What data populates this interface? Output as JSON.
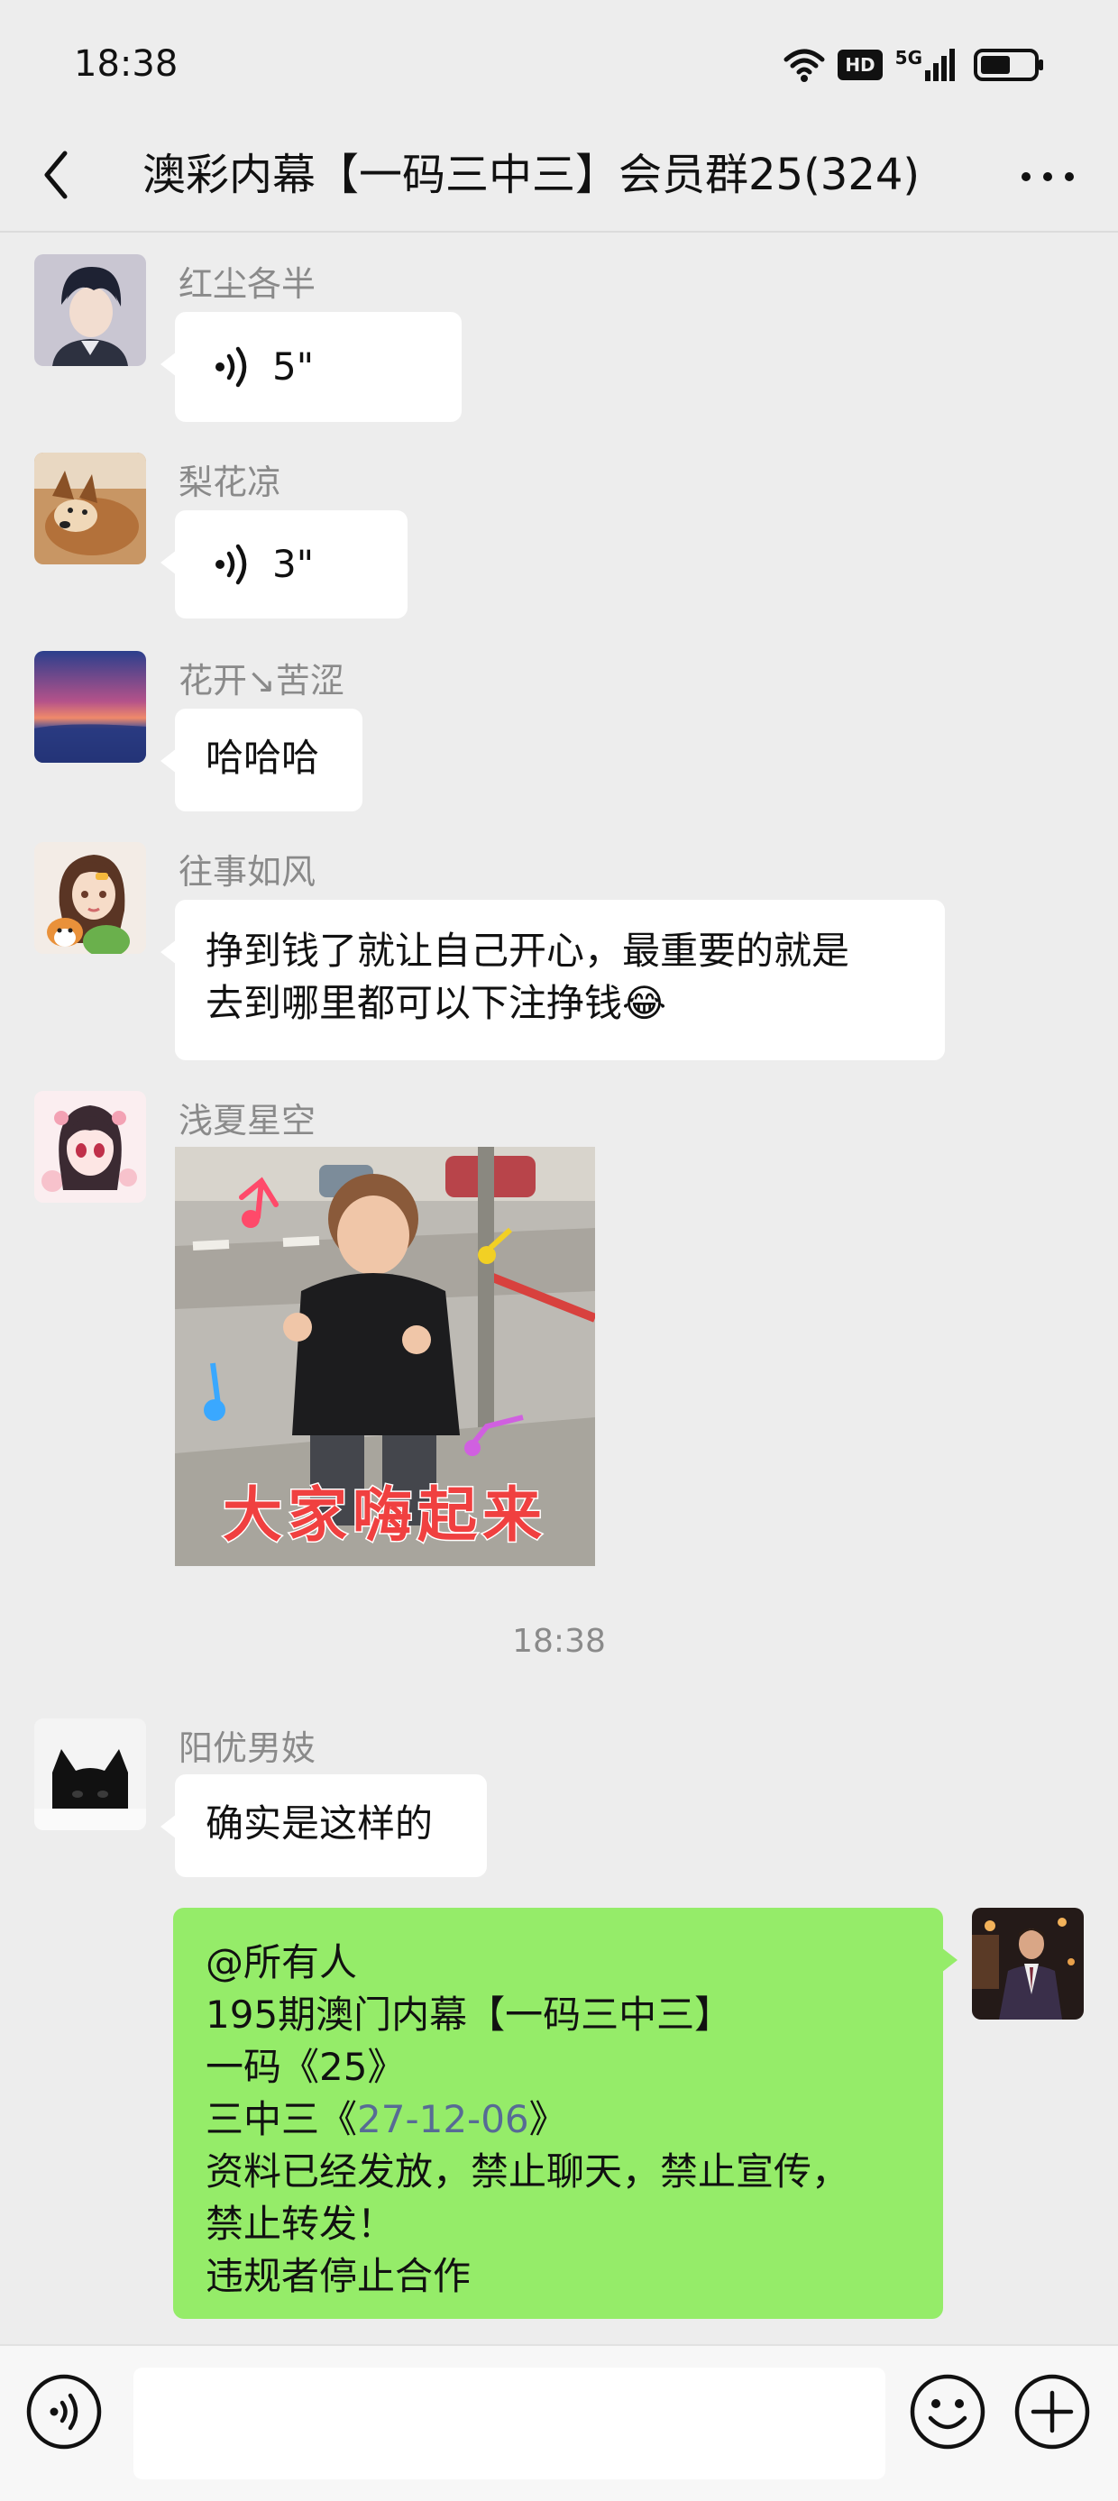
{
  "status": {
    "time": "18:38",
    "hd": "HD",
    "network": "5G",
    "icons": [
      "wifi-icon",
      "hd-icon",
      "signal-icon",
      "battery-icon"
    ]
  },
  "nav": {
    "title": "澳彩内幕【一码三中三】会员群25(324)",
    "back_icon": "chevron-left-icon",
    "more_icon": "more-icon"
  },
  "messages": [
    {
      "sender": "红尘各半",
      "type": "voice",
      "duration": "5\""
    },
    {
      "sender": "梨花凉",
      "type": "voice",
      "duration": "3\""
    },
    {
      "sender": "花开↘苦涩",
      "type": "text",
      "text": "哈哈哈"
    },
    {
      "sender": "往事如风",
      "type": "text",
      "lines": [
        "挣到钱了就让自己开心，最重要的就是",
        "去到哪里都可以下注挣钱"
      ],
      "emoji": "😂"
    },
    {
      "sender": "浅夏星空",
      "type": "sticker",
      "caption": "大家嗨起来"
    }
  ],
  "timestamp": "18:38",
  "later_messages": [
    {
      "sender": "阳优男妓",
      "type": "text",
      "text": "确实是这样的"
    }
  ],
  "own_message": {
    "line1": "@所有人",
    "line2": "195期澳门内幕【一码三中三】",
    "line3": "一码《25》",
    "line4_prefix": "三中三《",
    "line4_link": "27-12-06",
    "line4_suffix": "》",
    "line5": "资料已经发放，禁止聊天，禁止宣传，",
    "line6": "禁止转发！",
    "line7": "违规者停止合作"
  },
  "input_bar": {
    "voice_icon": "voice-input-icon",
    "emoji_icon": "emoji-icon",
    "plus_icon": "plus-icon",
    "placeholder": ""
  },
  "colors": {
    "background": "#ededed",
    "bubble_white": "#ffffff",
    "bubble_green": "#95ec69",
    "link": "#576b95",
    "sender_gray": "#8a8a8a"
  }
}
